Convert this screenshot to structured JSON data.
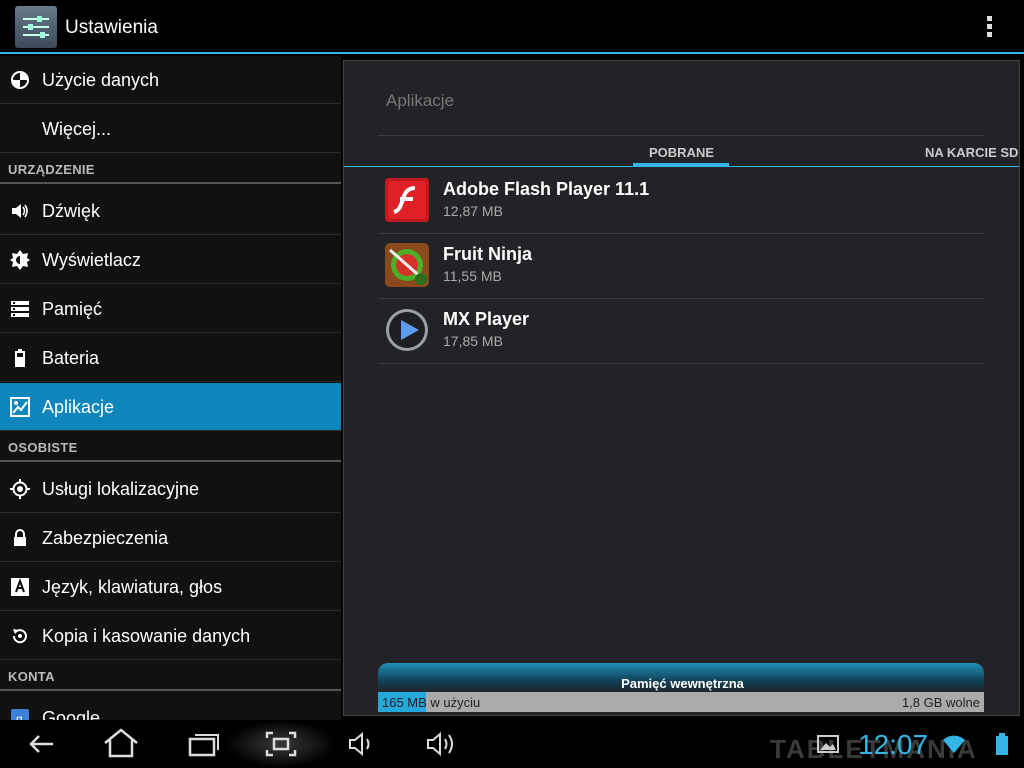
{
  "action_bar": {
    "title": "Ustawienia"
  },
  "sidebar": {
    "items": [
      {
        "label": "Użycie danych",
        "icon": "data-usage-icon"
      },
      {
        "label": "Więcej..."
      },
      {
        "header": "URZĄDZENIE"
      },
      {
        "label": "Dźwięk",
        "icon": "volume-icon"
      },
      {
        "label": "Wyświetlacz",
        "icon": "brightness-icon"
      },
      {
        "label": "Pamięć",
        "icon": "storage-icon"
      },
      {
        "label": "Bateria",
        "icon": "battery-icon"
      },
      {
        "label": "Aplikacje",
        "icon": "apps-icon",
        "active": true
      },
      {
        "header": "OSOBISTE"
      },
      {
        "label": "Usługi lokalizacyjne",
        "icon": "location-icon"
      },
      {
        "label": "Zabezpieczenia",
        "icon": "lock-icon"
      },
      {
        "label": "Język, klawiatura, głos",
        "icon": "language-icon"
      },
      {
        "label": "Kopia i kasowanie danych",
        "icon": "backup-icon"
      },
      {
        "header": "KONTA"
      },
      {
        "label": "Google",
        "icon": "google-icon"
      }
    ]
  },
  "main": {
    "title": "Aplikacje",
    "tabs": [
      {
        "label": "POBRANE",
        "active": true
      },
      {
        "label": "NA KARCIE SD"
      }
    ],
    "apps": [
      {
        "name": "Adobe Flash Player 11.1",
        "size": "12,87 MB",
        "icon": "flash-player-icon"
      },
      {
        "name": "Fruit Ninja",
        "size": "11,55 MB",
        "icon": "fruit-ninja-icon"
      },
      {
        "name": "MX Player",
        "size": "17,85 MB",
        "icon": "mx-player-icon"
      }
    ],
    "storage": {
      "title": "Pamięć wewnętrzna",
      "used": "165 MB w użyciu",
      "free": "1,8 GB wolne",
      "used_fraction": 0.08
    }
  },
  "status": {
    "time": "12:07"
  },
  "watermark": "TABLETMANIA",
  "colors": {
    "accent": "#33b5e5",
    "active_item": "#0e86bb",
    "panel": "#222326"
  }
}
